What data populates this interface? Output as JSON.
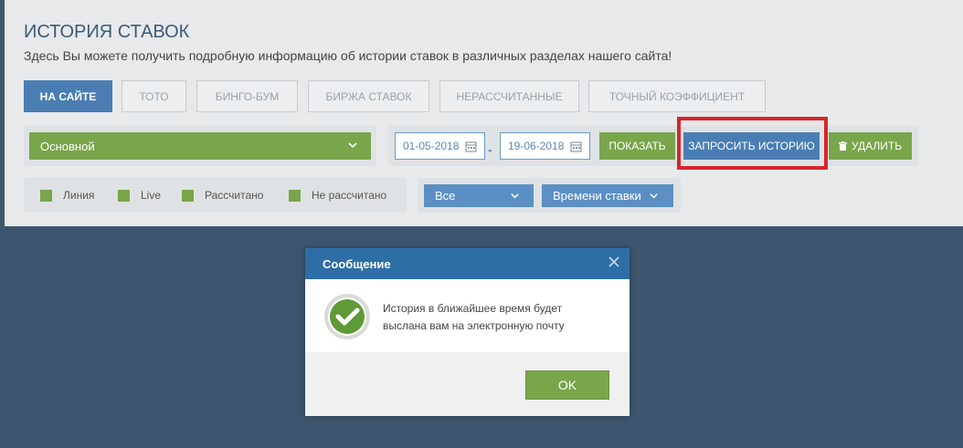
{
  "header": {
    "title": "ИСТОРИЯ СТАВОК",
    "subtitle": "Здесь Вы можете получить подробную информацию об истории ставок в различных разделах нашего сайта!"
  },
  "tabs": [
    {
      "label": "НА САЙТЕ",
      "active": true
    },
    {
      "label": "ТОТО"
    },
    {
      "label": "БИНГО-БУМ"
    },
    {
      "label": "БИРЖА СТАВОК"
    },
    {
      "label": "НЕРАССЧИТАННЫЕ"
    },
    {
      "label": "ТОЧНЫЙ КОЭФФИЦИЕНТ"
    }
  ],
  "filters": {
    "account_select": "Основной",
    "date_from": "01-05-2018",
    "date_to": "19-06-2018",
    "date_separator": "-",
    "show_label": "ПОКАЗАТЬ",
    "request_label": "ЗАПРОСИТЬ ИСТОРИЮ",
    "delete_label": "УДАЛИТЬ",
    "checkboxes": [
      "Линия",
      "Live",
      "Рассчитано",
      "Не рассчитано"
    ],
    "status_select": "Все",
    "sort_select": "Времени ставки"
  },
  "modal": {
    "title": "Сообщение",
    "message_line1": "История в ближайшее время будет",
    "message_line2": "выслана вам на электронную почту",
    "ok_label": "OK"
  },
  "colors": {
    "accent_blue": "#4a7eb3",
    "accent_green": "#79a54b",
    "highlight_red": "#d6252b",
    "background": "#3d566e"
  }
}
